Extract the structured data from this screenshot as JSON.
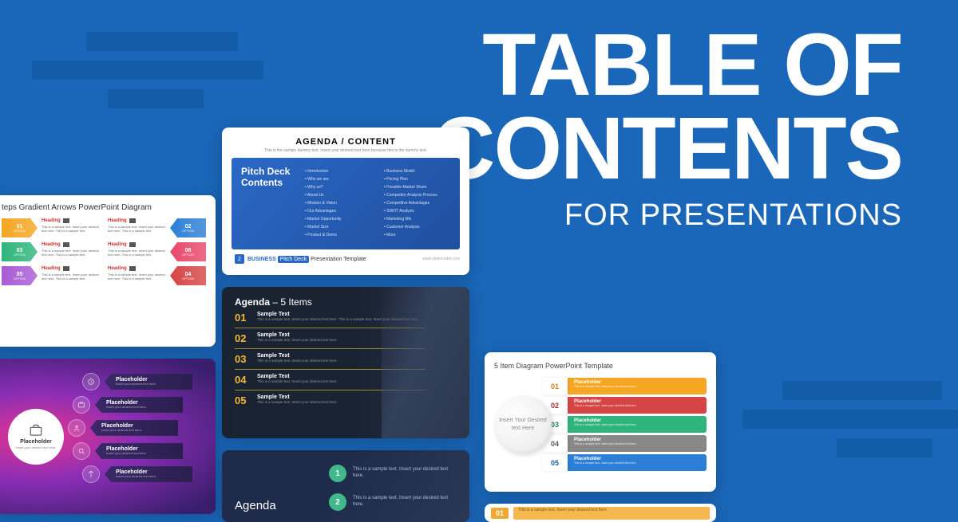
{
  "headline": {
    "line1": "TABLE OF",
    "line2": "CONTENTS",
    "sub": "FOR PRESENTATIONS"
  },
  "card1": {
    "header": "AGENDA / CONTENT",
    "header_sub": "This is the sample dummy text. Insert your desired text here because this is the dummy text.",
    "inner_title": "Pitch Deck Contents",
    "col1": [
      "Introduction",
      "Who we are",
      "Why us?",
      "About Us",
      "Mission & Vision",
      "Our Advantages",
      "Market Opportunity",
      "Market Size",
      "Product & Demo"
    ],
    "col2": [
      "Business Model",
      "Pricing Plan",
      "Possible Market Share",
      "Competitor Analysis Process",
      "Competitive Advantages",
      "SWOT Analysis",
      "Marketing Mix",
      "Customer Analysis",
      "More"
    ],
    "footer_num": "2",
    "footer_brand": "BUSINESS",
    "footer_brand2": "Pitch Deck",
    "footer_suffix": "Presentation Template",
    "footer_right": "www.slidemodel.com"
  },
  "card2": {
    "title": "teps Gradient Arrows PowerPoint Diagram",
    "cells": [
      {
        "n": "01",
        "opt": "OPTION",
        "h": "Heading",
        "p": "This is a sample text. Insert your desired text here. This is a sample text.",
        "c": "#f5a623"
      },
      {
        "n": "02",
        "opt": "OPTION",
        "h": "Heading",
        "p": "This is a sample text. Insert your desired text here. This is a sample text.",
        "c": "#2b7fd6"
      },
      {
        "n": "03",
        "opt": "OPTION",
        "h": "Heading",
        "p": "This is a sample text. Insert your desired text here. This is a sample text.",
        "c": "#2fb57c"
      },
      {
        "n": "06",
        "opt": "OPTION",
        "h": "Heading",
        "p": "This is a sample text. Insert your desired text here. This is a sample text.",
        "c": "#e8486b"
      },
      {
        "n": "05",
        "opt": "OPTION",
        "h": "Heading",
        "p": "This is a sample text. Insert your desired text here. This is a sample text.",
        "c": "#a85bd6"
      },
      {
        "n": "04",
        "opt": "OPTION",
        "h": "Heading",
        "p": "This is a sample text. Insert your desired text here. This is a sample text.",
        "c": "#d64545"
      }
    ]
  },
  "card3": {
    "title_strong": "Agenda",
    "title_light": " – 5 Items",
    "rows": [
      {
        "n": "01",
        "t": "Sample Text",
        "p": "This is a sample text. Insert your desired text here. This is a sample text. Insert your desired text here."
      },
      {
        "n": "02",
        "t": "Sample Text",
        "p": "This is a sample text. Insert your desired text here."
      },
      {
        "n": "03",
        "t": "Sample Text",
        "p": "This is a sample text. Insert your desired text here."
      },
      {
        "n": "04",
        "t": "Sample Text",
        "p": "This is a sample text. Insert your desired text here."
      },
      {
        "n": "05",
        "t": "Sample Text",
        "p": "This is a sample text. Insert your desired text here."
      }
    ]
  },
  "card4": {
    "hub_title": "Placeholder",
    "hub_sub": "Insert your desired text here.",
    "items": [
      {
        "t": "Placeholder",
        "s": "Insert your desired text here."
      },
      {
        "t": "Placeholder",
        "s": "Insert your desired text here."
      },
      {
        "t": "Placeholder",
        "s": "Insert your desired text here."
      },
      {
        "t": "Placeholder",
        "s": "Insert your desired text here."
      },
      {
        "t": "Placeholder",
        "s": "Insert your desired text here."
      }
    ]
  },
  "card5": {
    "title": "Agenda",
    "rows": [
      {
        "n": "1",
        "t": "This is a sample text. Insert your desired text here."
      },
      {
        "n": "2",
        "t": "This is a sample text. Insert your desired text here."
      }
    ]
  },
  "card6": {
    "title": "5 Item Diagram PowerPoint Template",
    "circle": "Insert Your Desired text Here",
    "bars": [
      {
        "n": "01",
        "t": "Placeholder",
        "s": "This is a sample text. Insert your desired text here.",
        "c": "#f5a623",
        "nc": "#c8841a"
      },
      {
        "n": "02",
        "t": "Placeholder",
        "s": "This is a sample text. Insert your desired text here.",
        "c": "#d64545",
        "nc": "#a83232"
      },
      {
        "n": "03",
        "t": "Placeholder",
        "s": "This is a sample text. Insert your desired text here.",
        "c": "#2fb57c",
        "nc": "#1f8858"
      },
      {
        "n": "04",
        "t": "Placeholder",
        "s": "This is a sample text. Insert your desired text here.",
        "c": "#888888",
        "nc": "#5a5a5a"
      },
      {
        "n": "05",
        "t": "Placeholder",
        "s": "This is a sample text. Insert your desired text here.",
        "c": "#2b7fd6",
        "nc": "#1f5fa0"
      }
    ]
  },
  "card7": {
    "n": "01",
    "t": "This is a sample text. Insert your desired text here."
  }
}
